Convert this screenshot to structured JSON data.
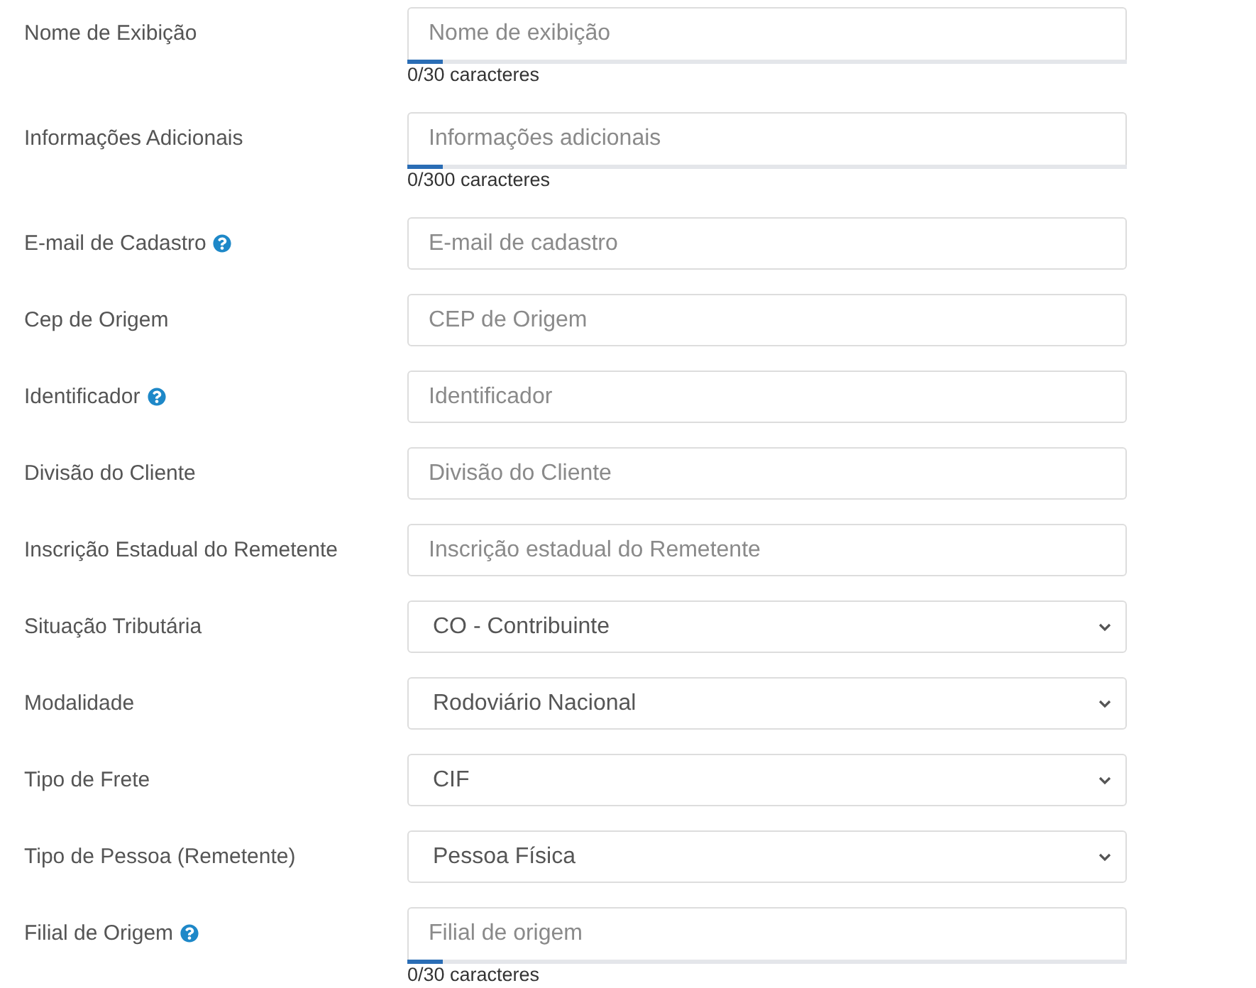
{
  "fields": [
    {
      "kind": "text",
      "label": "Nome de Exibição",
      "help": false,
      "placeholder": "Nome de exibição",
      "counter": "0/30 caracteres",
      "level": 0.05
    },
    {
      "kind": "text",
      "label": "Informações Adicionais",
      "help": false,
      "placeholder": "Informações adicionais",
      "counter": "0/300 caracteres",
      "level": 0.05
    },
    {
      "kind": "text",
      "label": "E-mail de Cadastro",
      "help": true,
      "placeholder": "E-mail de cadastro"
    },
    {
      "kind": "text",
      "label": "Cep de Origem",
      "help": false,
      "placeholder": "CEP de Origem"
    },
    {
      "kind": "text",
      "label": "Identificador",
      "help": true,
      "placeholder": "Identificador"
    },
    {
      "kind": "text",
      "label": "Divisão do Cliente",
      "help": false,
      "placeholder": "Divisão do Cliente"
    },
    {
      "kind": "text",
      "label": "Inscrição Estadual do Remetente",
      "help": false,
      "placeholder": "Inscrição estadual do Remetente"
    },
    {
      "kind": "select",
      "label": "Situação Tributária",
      "help": false,
      "value": "CO - Contribuinte"
    },
    {
      "kind": "select",
      "label": "Modalidade",
      "help": false,
      "value": "Rodoviário Nacional"
    },
    {
      "kind": "select",
      "label": "Tipo de Frete",
      "help": false,
      "value": "CIF"
    },
    {
      "kind": "select",
      "label": "Tipo de Pessoa (Remetente)",
      "help": false,
      "value": "Pessoa Física"
    },
    {
      "kind": "text",
      "label": "Filial de Origem",
      "help": true,
      "placeholder": "Filial de origem",
      "counter": "0/30 caracteres",
      "level": 0.05
    }
  ]
}
